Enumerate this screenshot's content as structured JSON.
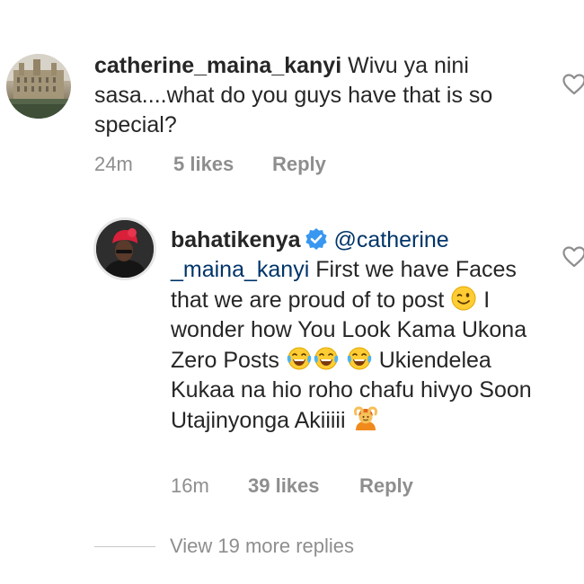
{
  "comment1": {
    "username": "catherine_maina_kanyi",
    "text": " Wivu ya nini sasa....what do you guys  have that is so special?",
    "time": "24m",
    "likes": "5 likes",
    "reply": "Reply",
    "avatar": "building-photo"
  },
  "comment2": {
    "username": "bahatikenya",
    "verified_icon": "verified-badge-icon",
    "mention": "@catherine _maina_kanyi",
    "text_part1": " First we have Faces that we are proud of to post ",
    "text_part2": " I wonder how You Look Kama Ukona Zero Posts ",
    "text_part3": " Ukiendelea Kukaa na hio roho chafu hivyo Soon Utajinyonga Akiiiii ",
    "emoji1": "winking-face",
    "emoji2": "tears-of-joy-face",
    "emoji3": "woman-gesturing-ok",
    "time": "16m",
    "likes": "39 likes",
    "reply": "Reply",
    "avatar": "person-red-hat-photo"
  },
  "replies": {
    "view_more": "View 19 more replies"
  },
  "colors": {
    "meta_gray": "#8e8e8e",
    "text": "#262626",
    "mention": "#003569",
    "verified_blue": "#3897f0"
  }
}
